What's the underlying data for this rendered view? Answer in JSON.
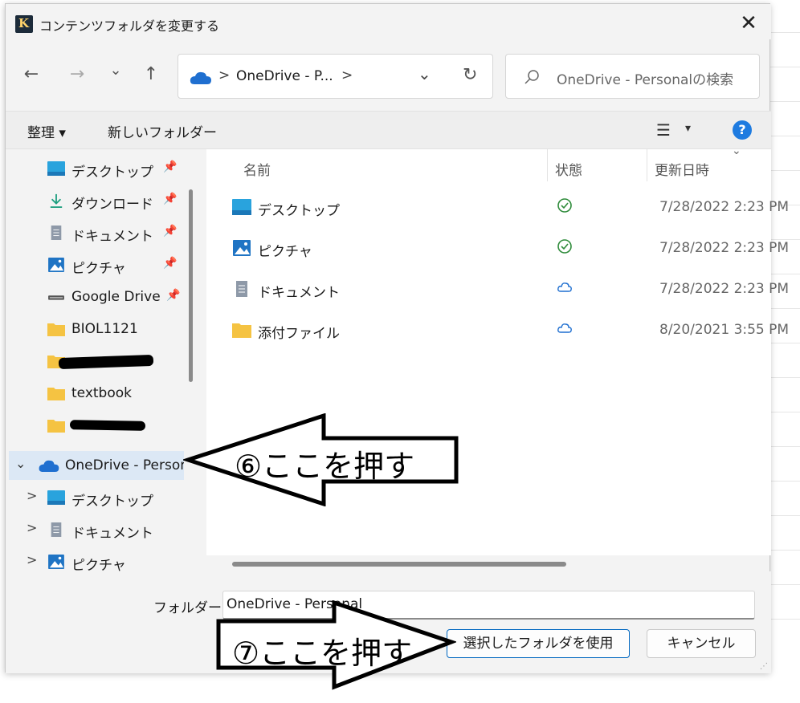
{
  "window": {
    "title": "コンテンツフォルダを変更する",
    "close_glyph": "✕"
  },
  "nav": {
    "back_glyph": "←",
    "forward_glyph": "→",
    "recent_glyph": "⌄",
    "up_glyph": "↑"
  },
  "address": {
    "separator": ">",
    "location": "OneDrive - P...",
    "trailing_separator": ">",
    "dropdown_glyph": "⌄",
    "refresh_glyph": "↻"
  },
  "search": {
    "placeholder": "OneDrive - Personalの検索"
  },
  "toolbar": {
    "organize_label": "整理 ▾",
    "new_folder_label": "新しいフォルダー",
    "view_glyph": "☰",
    "view_dropdown_glyph": "▾",
    "help_glyph": "?"
  },
  "sidebar": {
    "items": [
      {
        "label": "デスクトップ",
        "icon": "desktop-icon",
        "pinned": true
      },
      {
        "label": "ダウンロード",
        "icon": "download-icon",
        "pinned": true
      },
      {
        "label": "ドキュメント",
        "icon": "document-icon",
        "pinned": true
      },
      {
        "label": "ピクチャ",
        "icon": "picture-icon",
        "pinned": true
      },
      {
        "label": "Google Drive",
        "icon": "drive-icon",
        "pinned": true
      },
      {
        "label": "BIOL1121",
        "icon": "folder-icon",
        "pinned": false
      },
      {
        "label": "",
        "icon": "folder-icon",
        "pinned": false
      },
      {
        "label": "textbook",
        "icon": "folder-icon",
        "pinned": false
      },
      {
        "label": "",
        "icon": "folder-icon",
        "pinned": false
      }
    ],
    "onedrive": {
      "label": "OneDrive - Persor",
      "expand_glyph": "⌄"
    },
    "children": [
      {
        "label": "デスクトップ",
        "icon": "desktop-icon",
        "expand_glyph": ">"
      },
      {
        "label": "ドキュメント",
        "icon": "document-icon",
        "expand_glyph": ">"
      },
      {
        "label": "ピクチャ",
        "icon": "picture-icon",
        "expand_glyph": ">"
      }
    ],
    "pin_glyph": "📌"
  },
  "filelist": {
    "columns": {
      "name": "名前",
      "status": "状態",
      "modified": "更新日時"
    },
    "sort_glyph": "⌄",
    "rows": [
      {
        "name": "デスクトップ",
        "icon": "desktop-icon",
        "status": "synced",
        "modified": "7/28/2022 2:23 PM"
      },
      {
        "name": "ピクチャ",
        "icon": "picture-icon",
        "status": "synced",
        "modified": "7/28/2022 2:23 PM"
      },
      {
        "name": "ドキュメント",
        "icon": "document-icon",
        "status": "cloud",
        "modified": "7/28/2022 2:23 PM"
      },
      {
        "name": "添付ファイル",
        "icon": "folder-icon",
        "status": "cloud",
        "modified": "8/20/2021 3:55 PM"
      }
    ]
  },
  "footer": {
    "folder_label": "フォルダー:",
    "folder_value": "OneDrive - Personal",
    "use_button": "選択したフォルダを使用",
    "cancel_button": "キャンセル"
  },
  "annotations": {
    "step6": "⑥ここを押す",
    "step7": "⑦ここを押す"
  },
  "colors": {
    "accent": "#0067c0",
    "onedrive": "#1f6fd0",
    "synced": "#2e8b3a",
    "folder": "#f5c342",
    "selected_bg": "#dce8f5"
  }
}
